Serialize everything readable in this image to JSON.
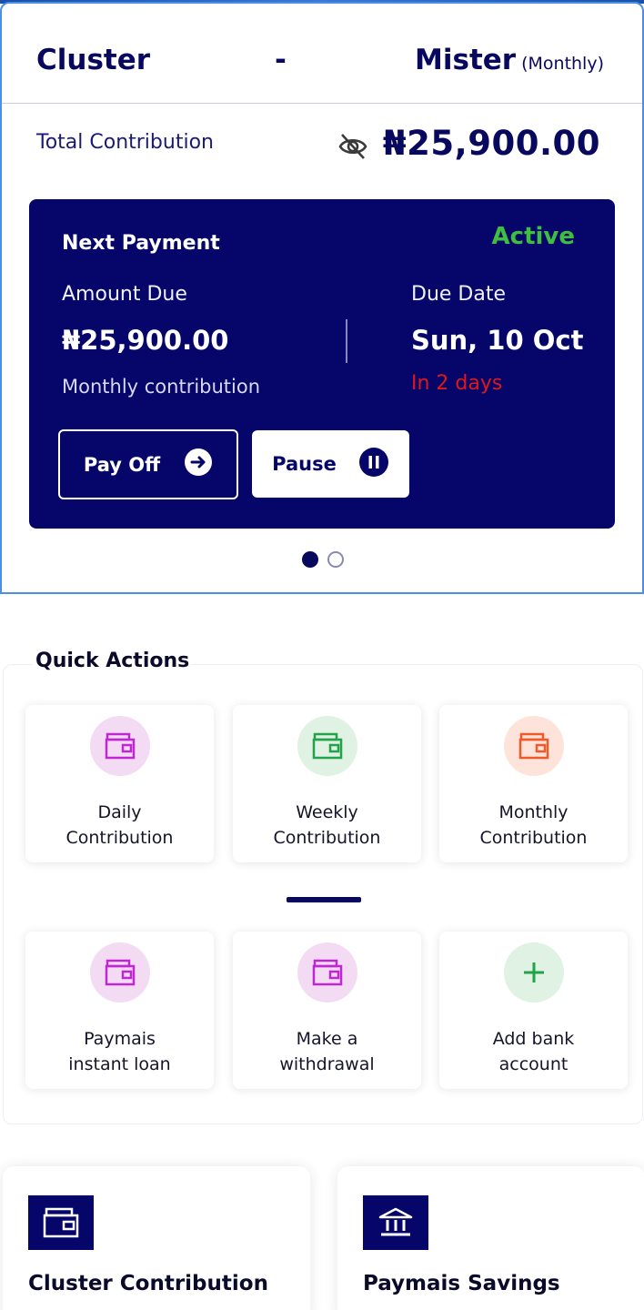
{
  "header": {
    "group_name": "Cluster",
    "separator": "-",
    "member_name": "Mister",
    "frequency": "(Monthly)"
  },
  "total": {
    "label": "Total Contribution",
    "value": "₦25,900.00",
    "visibility_icon": "eye-off-icon"
  },
  "next_payment": {
    "heading": "Next Payment",
    "status": "Active",
    "amount_label": "Amount Due",
    "amount": "₦25,900.00",
    "amount_note": "Monthly contribution",
    "due_label": "Due Date",
    "due_date": "Sun, 10 Oct",
    "due_in": "In 2 days",
    "pay_off_label": "Pay Off",
    "pause_label": "Pause"
  },
  "carousel": {
    "pages": 2,
    "active_page": 1
  },
  "quick_actions": {
    "title": "Quick Actions",
    "items": [
      {
        "line1": "Daily",
        "line2": "Contribution",
        "icon": "wallet-icon",
        "color": "#c026d3",
        "bg": "#f3dcf3"
      },
      {
        "line1": "Weekly",
        "line2": "Contribution",
        "icon": "wallet-icon",
        "color": "#22a34a",
        "bg": "#dff2e3"
      },
      {
        "line1": "Monthly",
        "line2": "Contribution",
        "icon": "wallet-icon",
        "color": "#f05a2a",
        "bg": "#fde3da"
      },
      {
        "line1": "Paymais",
        "line2": "instant loan",
        "icon": "wallet-icon",
        "color": "#c026d3",
        "bg": "#f3dcf3"
      },
      {
        "line1": "Make a",
        "line2": "withdrawal",
        "icon": "wallet-icon",
        "color": "#c026d3",
        "bg": "#f3dcf3"
      },
      {
        "line1": "Add bank",
        "line2": "account",
        "icon": "plus-icon",
        "color": "#22a34a",
        "bg": "#dff2e3"
      }
    ]
  },
  "shortcuts": [
    {
      "label": "Cluster Contribution",
      "icon": "wallet-icon"
    },
    {
      "label": "Paymais Savings",
      "icon": "bank-icon"
    }
  ],
  "colors": {
    "primary": "#05056a",
    "active_status": "#3fbf3f",
    "warning": "#e01818",
    "card_border": "#4a90e2"
  }
}
